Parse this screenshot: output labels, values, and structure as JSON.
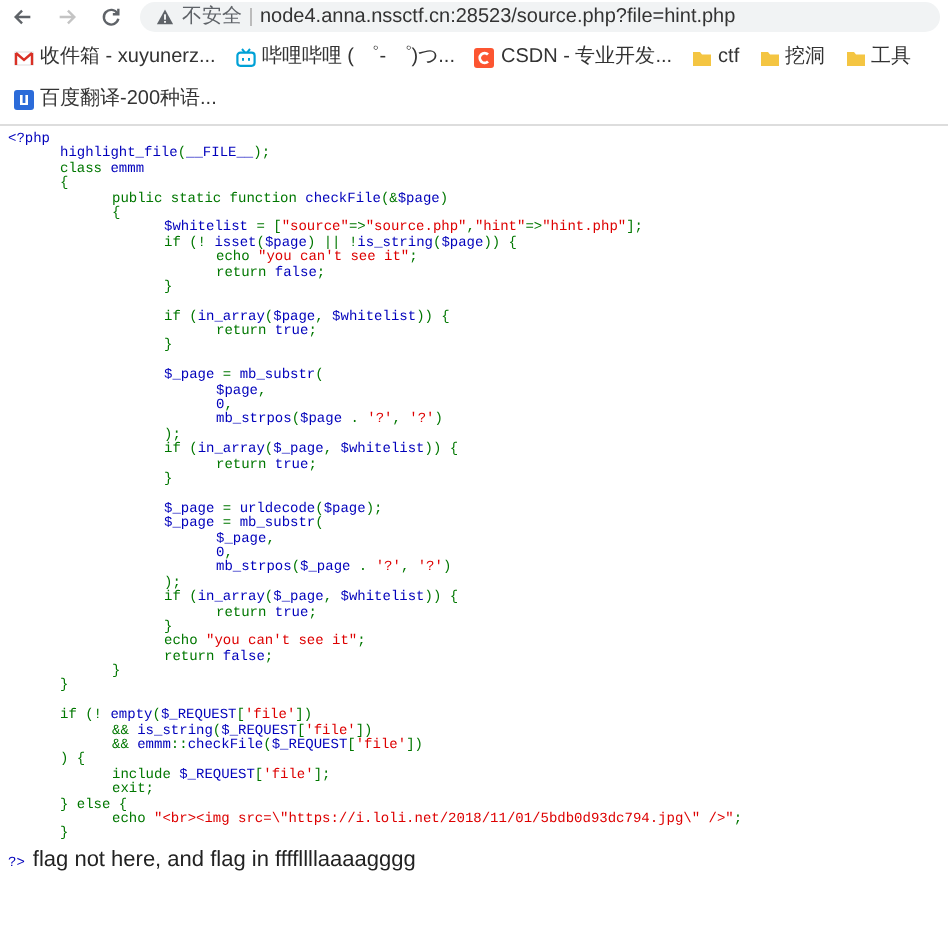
{
  "browser": {
    "nav_buttons": [
      {
        "kind": "back",
        "disabled": false
      },
      {
        "kind": "forward",
        "disabled": true
      },
      {
        "kind": "reload",
        "disabled": false
      }
    ],
    "address_bar": {
      "security_label": "不安全",
      "url": "node4.anna.nssctf.cn:28523/source.php?file=hint.php"
    },
    "bookmarks": [
      {
        "kind": "mail",
        "label": "收件箱 - xuyunerz..."
      },
      {
        "kind": "tv",
        "label": "哔哩哔哩 ( ゜- ゜)つ..."
      },
      {
        "kind": "csdn",
        "label": "CSDN - 专业开发..."
      },
      {
        "kind": "folder",
        "label": "ctf"
      },
      {
        "kind": "folder",
        "label": "挖洞"
      },
      {
        "kind": "folder",
        "label": "工具"
      },
      {
        "kind": "translate",
        "label": "百度翻译-200种语..."
      }
    ]
  },
  "source_code": {
    "blocks": [
      [
        [
          {
            "kind": "default",
            "text": "<?php"
          }
        ],
        [
          {
            "kind": "default",
            "text": "\thighlight_file"
          },
          {
            "kind": "keyword",
            "text": "("
          },
          {
            "kind": "default",
            "text": "__FILE__"
          },
          {
            "kind": "keyword",
            "text": ");"
          }
        ],
        [
          {
            "kind": "keyword",
            "text": "\tclass "
          },
          {
            "kind": "default",
            "text": "emmm"
          }
        ],
        [
          {
            "kind": "keyword",
            "text": "\t{"
          }
        ],
        [
          {
            "kind": "keyword",
            "text": "\t\tpublic static function "
          },
          {
            "kind": "default",
            "text": "checkFile"
          },
          {
            "kind": "keyword",
            "text": "(&"
          },
          {
            "kind": "default",
            "text": "$page"
          },
          {
            "kind": "keyword",
            "text": ")"
          }
        ],
        [
          {
            "kind": "keyword",
            "text": "\t\t{"
          }
        ],
        [
          {
            "kind": "default",
            "text": "\t\t\t$whitelist "
          },
          {
            "kind": "keyword",
            "text": "= ["
          },
          {
            "kind": "string",
            "text": "\"source\""
          },
          {
            "kind": "keyword",
            "text": "=>"
          },
          {
            "kind": "string",
            "text": "\"source.php\""
          },
          {
            "kind": "keyword",
            "text": ","
          },
          {
            "kind": "string",
            "text": "\"hint\""
          },
          {
            "kind": "keyword",
            "text": "=>"
          },
          {
            "kind": "string",
            "text": "\"hint.php\""
          },
          {
            "kind": "keyword",
            "text": "];"
          }
        ],
        [
          {
            "kind": "keyword",
            "text": "\t\t\tif (! "
          },
          {
            "kind": "default",
            "text": "isset"
          },
          {
            "kind": "keyword",
            "text": "("
          },
          {
            "kind": "default",
            "text": "$page"
          },
          {
            "kind": "keyword",
            "text": ") || !"
          },
          {
            "kind": "default",
            "text": "is_string"
          },
          {
            "kind": "keyword",
            "text": "("
          },
          {
            "kind": "default",
            "text": "$page"
          },
          {
            "kind": "keyword",
            "text": ")) {"
          }
        ],
        [
          {
            "kind": "keyword",
            "text": "\t\t\t\techo "
          },
          {
            "kind": "string",
            "text": "\"you can't see it\""
          },
          {
            "kind": "keyword",
            "text": ";"
          }
        ],
        [
          {
            "kind": "keyword",
            "text": "\t\t\t\treturn "
          },
          {
            "kind": "default",
            "text": "false"
          },
          {
            "kind": "keyword",
            "text": ";"
          }
        ],
        [
          {
            "kind": "keyword",
            "text": "\t\t\t}"
          }
        ]
      ],
      [
        [
          {
            "kind": "keyword",
            "text": "\t\t\tif ("
          },
          {
            "kind": "default",
            "text": "in_array"
          },
          {
            "kind": "keyword",
            "text": "("
          },
          {
            "kind": "default",
            "text": "$page"
          },
          {
            "kind": "keyword",
            "text": ", "
          },
          {
            "kind": "default",
            "text": "$whitelist"
          },
          {
            "kind": "keyword",
            "text": ")) {"
          }
        ],
        [
          {
            "kind": "keyword",
            "text": "\t\t\t\treturn "
          },
          {
            "kind": "default",
            "text": "true"
          },
          {
            "kind": "keyword",
            "text": ";"
          }
        ],
        [
          {
            "kind": "keyword",
            "text": "\t\t\t}"
          }
        ]
      ],
      [
        [
          {
            "kind": "default",
            "text": "\t\t\t$_page "
          },
          {
            "kind": "keyword",
            "text": "= "
          },
          {
            "kind": "default",
            "text": "mb_substr"
          },
          {
            "kind": "keyword",
            "text": "("
          }
        ],
        [
          {
            "kind": "default",
            "text": "\t\t\t\t$page"
          },
          {
            "kind": "keyword",
            "text": ","
          }
        ],
        [
          {
            "kind": "default",
            "text": "\t\t\t\t0"
          },
          {
            "kind": "keyword",
            "text": ","
          }
        ],
        [
          {
            "kind": "default",
            "text": "\t\t\t\tmb_strpos"
          },
          {
            "kind": "keyword",
            "text": "("
          },
          {
            "kind": "default",
            "text": "$page "
          },
          {
            "kind": "keyword",
            "text": ". "
          },
          {
            "kind": "string",
            "text": "'?'"
          },
          {
            "kind": "keyword",
            "text": ", "
          },
          {
            "kind": "string",
            "text": "'?'"
          },
          {
            "kind": "keyword",
            "text": ")"
          }
        ],
        [
          {
            "kind": "keyword",
            "text": "\t\t\t);"
          }
        ],
        [
          {
            "kind": "keyword",
            "text": "\t\t\tif ("
          },
          {
            "kind": "default",
            "text": "in_array"
          },
          {
            "kind": "keyword",
            "text": "("
          },
          {
            "kind": "default",
            "text": "$_page"
          },
          {
            "kind": "keyword",
            "text": ", "
          },
          {
            "kind": "default",
            "text": "$whitelist"
          },
          {
            "kind": "keyword",
            "text": ")) {"
          }
        ],
        [
          {
            "kind": "keyword",
            "text": "\t\t\t\treturn "
          },
          {
            "kind": "default",
            "text": "true"
          },
          {
            "kind": "keyword",
            "text": ";"
          }
        ],
        [
          {
            "kind": "keyword",
            "text": "\t\t\t}"
          }
        ]
      ],
      [
        [
          {
            "kind": "default",
            "text": "\t\t\t$_page "
          },
          {
            "kind": "keyword",
            "text": "= "
          },
          {
            "kind": "default",
            "text": "urldecode"
          },
          {
            "kind": "keyword",
            "text": "("
          },
          {
            "kind": "default",
            "text": "$page"
          },
          {
            "kind": "keyword",
            "text": ");"
          }
        ],
        [
          {
            "kind": "default",
            "text": "\t\t\t$_page "
          },
          {
            "kind": "keyword",
            "text": "= "
          },
          {
            "kind": "default",
            "text": "mb_substr"
          },
          {
            "kind": "keyword",
            "text": "("
          }
        ],
        [
          {
            "kind": "default",
            "text": "\t\t\t\t$_page"
          },
          {
            "kind": "keyword",
            "text": ","
          }
        ],
        [
          {
            "kind": "default",
            "text": "\t\t\t\t0"
          },
          {
            "kind": "keyword",
            "text": ","
          }
        ],
        [
          {
            "kind": "default",
            "text": "\t\t\t\tmb_strpos"
          },
          {
            "kind": "keyword",
            "text": "("
          },
          {
            "kind": "default",
            "text": "$_page "
          },
          {
            "kind": "keyword",
            "text": ". "
          },
          {
            "kind": "string",
            "text": "'?'"
          },
          {
            "kind": "keyword",
            "text": ", "
          },
          {
            "kind": "string",
            "text": "'?'"
          },
          {
            "kind": "keyword",
            "text": ")"
          }
        ],
        [
          {
            "kind": "keyword",
            "text": "\t\t\t);"
          }
        ],
        [
          {
            "kind": "keyword",
            "text": "\t\t\tif ("
          },
          {
            "kind": "default",
            "text": "in_array"
          },
          {
            "kind": "keyword",
            "text": "("
          },
          {
            "kind": "default",
            "text": "$_page"
          },
          {
            "kind": "keyword",
            "text": ", "
          },
          {
            "kind": "default",
            "text": "$whitelist"
          },
          {
            "kind": "keyword",
            "text": ")) {"
          }
        ],
        [
          {
            "kind": "keyword",
            "text": "\t\t\t\treturn "
          },
          {
            "kind": "default",
            "text": "true"
          },
          {
            "kind": "keyword",
            "text": ";"
          }
        ],
        [
          {
            "kind": "keyword",
            "text": "\t\t\t}"
          }
        ],
        [
          {
            "kind": "keyword",
            "text": "\t\t\techo "
          },
          {
            "kind": "string",
            "text": "\"you can't see it\""
          },
          {
            "kind": "keyword",
            "text": ";"
          }
        ],
        [
          {
            "kind": "keyword",
            "text": "\t\t\treturn "
          },
          {
            "kind": "default",
            "text": "false"
          },
          {
            "kind": "keyword",
            "text": ";"
          }
        ],
        [
          {
            "kind": "keyword",
            "text": "\t\t}"
          }
        ],
        [
          {
            "kind": "keyword",
            "text": "\t}"
          }
        ]
      ],
      [
        [
          {
            "kind": "keyword",
            "text": "\tif (! "
          },
          {
            "kind": "default",
            "text": "empty"
          },
          {
            "kind": "keyword",
            "text": "("
          },
          {
            "kind": "default",
            "text": "$_REQUEST"
          },
          {
            "kind": "keyword",
            "text": "["
          },
          {
            "kind": "string",
            "text": "'file'"
          },
          {
            "kind": "keyword",
            "text": "])"
          }
        ],
        [
          {
            "kind": "keyword",
            "text": "\t\t&& "
          },
          {
            "kind": "default",
            "text": "is_string"
          },
          {
            "kind": "keyword",
            "text": "("
          },
          {
            "kind": "default",
            "text": "$_REQUEST"
          },
          {
            "kind": "keyword",
            "text": "["
          },
          {
            "kind": "string",
            "text": "'file'"
          },
          {
            "kind": "keyword",
            "text": "])"
          }
        ],
        [
          {
            "kind": "keyword",
            "text": "\t\t&& "
          },
          {
            "kind": "default",
            "text": "emmm"
          },
          {
            "kind": "keyword",
            "text": "::"
          },
          {
            "kind": "default",
            "text": "checkFile"
          },
          {
            "kind": "keyword",
            "text": "("
          },
          {
            "kind": "default",
            "text": "$_REQUEST"
          },
          {
            "kind": "keyword",
            "text": "["
          },
          {
            "kind": "string",
            "text": "'file'"
          },
          {
            "kind": "keyword",
            "text": "])"
          }
        ],
        [
          {
            "kind": "keyword",
            "text": "\t) {"
          }
        ],
        [
          {
            "kind": "keyword",
            "text": "\t\tinclude "
          },
          {
            "kind": "default",
            "text": "$_REQUEST"
          },
          {
            "kind": "keyword",
            "text": "["
          },
          {
            "kind": "string",
            "text": "'file'"
          },
          {
            "kind": "keyword",
            "text": "];"
          }
        ],
        [
          {
            "kind": "keyword",
            "text": "\t\texit;"
          }
        ],
        [
          {
            "kind": "keyword",
            "text": "\t} else {"
          }
        ],
        [
          {
            "kind": "keyword",
            "text": "\t\techo "
          },
          {
            "kind": "string",
            "text": "\"<br><img src=\\\"https://i.loli.net/2018/11/01/5bdb0d93dc794.jpg\\\" />\""
          },
          {
            "kind": "keyword",
            "text": ";"
          }
        ],
        [
          {
            "kind": "keyword",
            "text": "\t}"
          }
        ]
      ]
    ],
    "closing_tag": "?>"
  },
  "output_text": "flag not here, and flag in ffffllllaaaagggg"
}
